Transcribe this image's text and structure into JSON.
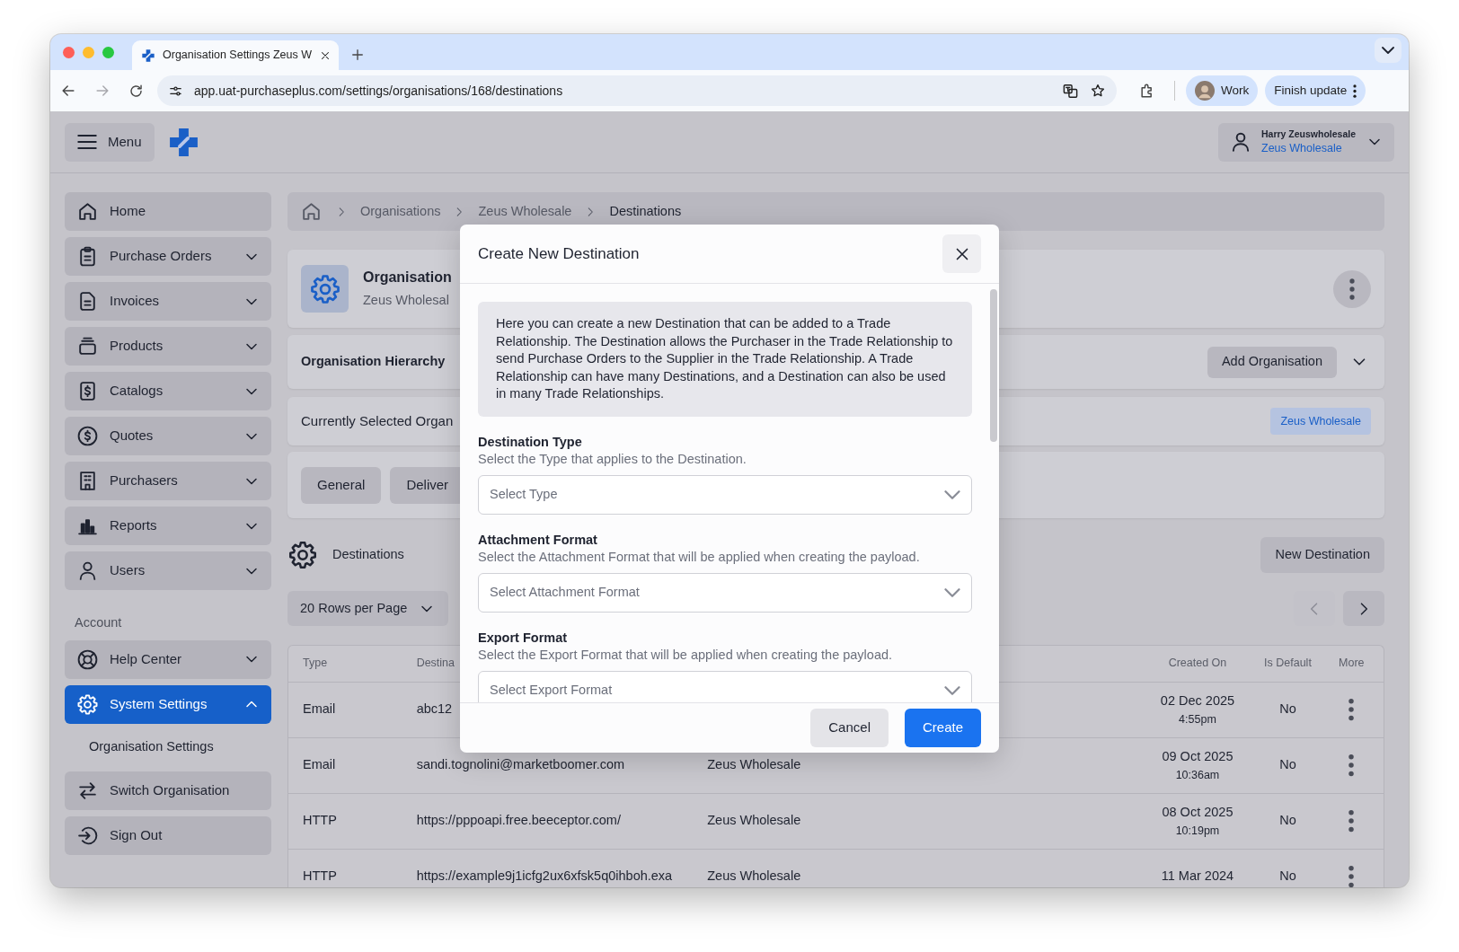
{
  "browser": {
    "tab_title": "Organisation Settings Zeus W",
    "url": "app.uat-purchaseplus.com/settings/organisations/168/destinations",
    "profile": "Work",
    "update_button": "Finish update"
  },
  "header": {
    "menu_label": "Menu",
    "user_name": "Harry Zeuswholesale",
    "user_org": "Zeus Wholesale"
  },
  "sidebar": {
    "items": [
      {
        "label": "Home",
        "kind": "link",
        "selected": false
      },
      {
        "label": "Purchase Orders",
        "kind": "group",
        "selected": false,
        "expanded": false
      },
      {
        "label": "Invoices",
        "kind": "group",
        "selected": false,
        "expanded": false
      },
      {
        "label": "Products",
        "kind": "group",
        "selected": false,
        "expanded": false
      },
      {
        "label": "Catalogs",
        "kind": "group",
        "selected": false,
        "expanded": false
      },
      {
        "label": "Quotes",
        "kind": "group",
        "selected": false,
        "expanded": false
      },
      {
        "label": "Purchasers",
        "kind": "group",
        "selected": false,
        "expanded": false
      },
      {
        "label": "Reports",
        "kind": "group",
        "selected": false,
        "expanded": false
      },
      {
        "label": "Users",
        "kind": "group",
        "selected": false,
        "expanded": false
      }
    ],
    "account_label": "Account",
    "account_items": [
      {
        "label": "Help Center",
        "kind": "group",
        "selected": false,
        "expanded": false
      },
      {
        "label": "System Settings",
        "kind": "group",
        "selected": true,
        "expanded": true,
        "children": [
          {
            "label": "Organisation Settings",
            "selected": false
          }
        ]
      },
      {
        "label": "Switch Organisation",
        "kind": "link",
        "selected": false
      },
      {
        "label": "Sign Out",
        "kind": "link",
        "selected": false
      }
    ]
  },
  "breadcrumb": [
    {
      "label": "Organisations",
      "kind": "link"
    },
    {
      "label": "Zeus Wholesale",
      "kind": "link"
    },
    {
      "label": "Destinations",
      "kind": "current"
    }
  ],
  "organisation_card": {
    "title": "Organisation",
    "subtitle": "Zeus Wholesal"
  },
  "hierarchy": {
    "title": "Organisation Hierarchy",
    "button": "Add Organisation",
    "expanded": false
  },
  "current_selection": {
    "label": "Currently Selected Organ",
    "tag": "Zeus Wholesale"
  },
  "tabs": [
    {
      "label": "General",
      "selected": false
    },
    {
      "label": "Deliver",
      "selected": false
    }
  ],
  "destinations": {
    "title": "Destinations",
    "new_button": "New Destination",
    "rows_per_page": "20 Rows per Page",
    "previous_disabled": true,
    "next_disabled": false
  },
  "table": {
    "columns": {
      "type": "Type",
      "destination": "Destina",
      "created_on": "Created On",
      "is_default": "Is Default",
      "more": "More"
    },
    "rows": [
      {
        "type": "Email",
        "destination": "abc12",
        "created_date": "02 Dec 2025",
        "created_time": "4:55pm",
        "is_default": "No"
      },
      {
        "type": "Email",
        "destination": "sandi.tognolini@marketboomer.com",
        "column_3": "Zeus Wholesale",
        "created_date": "09 Oct 2025",
        "created_time": "10:36am",
        "is_default": "No"
      },
      {
        "type": "HTTP",
        "destination": "https://pppoapi.free.beeceptor.com/",
        "column_3": "Zeus Wholesale",
        "created_date": "08 Oct 2025",
        "created_time": "10:19pm",
        "is_default": "No"
      },
      {
        "type": "HTTP",
        "destination": "https://example9j1icfg2ux6xfsk5q0ihboh.exa",
        "column_3": "Zeus Wholesale",
        "created_date": "11 Mar 2024",
        "is_default": "No"
      }
    ]
  },
  "dialog": {
    "title": "Create New Destination",
    "intro": "Here you can create a new Destination that can be added to a Trade Relationship. The Destination allows the Purchaser in the Trade Relationship to send Purchase Orders to the Supplier in the Trade Relationship. A Trade Relationship can have many Destinations, and a Destination can also be used in many Trade Relationships.",
    "fields": [
      {
        "label": "Destination Type",
        "help": "Select the Type that applies to the Destination.",
        "placeholder": "Select Type"
      },
      {
        "label": "Attachment Format",
        "help": "Select the Attachment Format that will be applied when creating the payload.",
        "placeholder": "Select Attachment Format"
      },
      {
        "label": "Export Format",
        "help": "Select the Export Format that will be applied when creating the payload.",
        "placeholder": "Select Export Format"
      }
    ],
    "buttons": [
      {
        "label": "Cancel",
        "kind": "secondary"
      },
      {
        "label": "Create",
        "kind": "primary"
      }
    ]
  }
}
